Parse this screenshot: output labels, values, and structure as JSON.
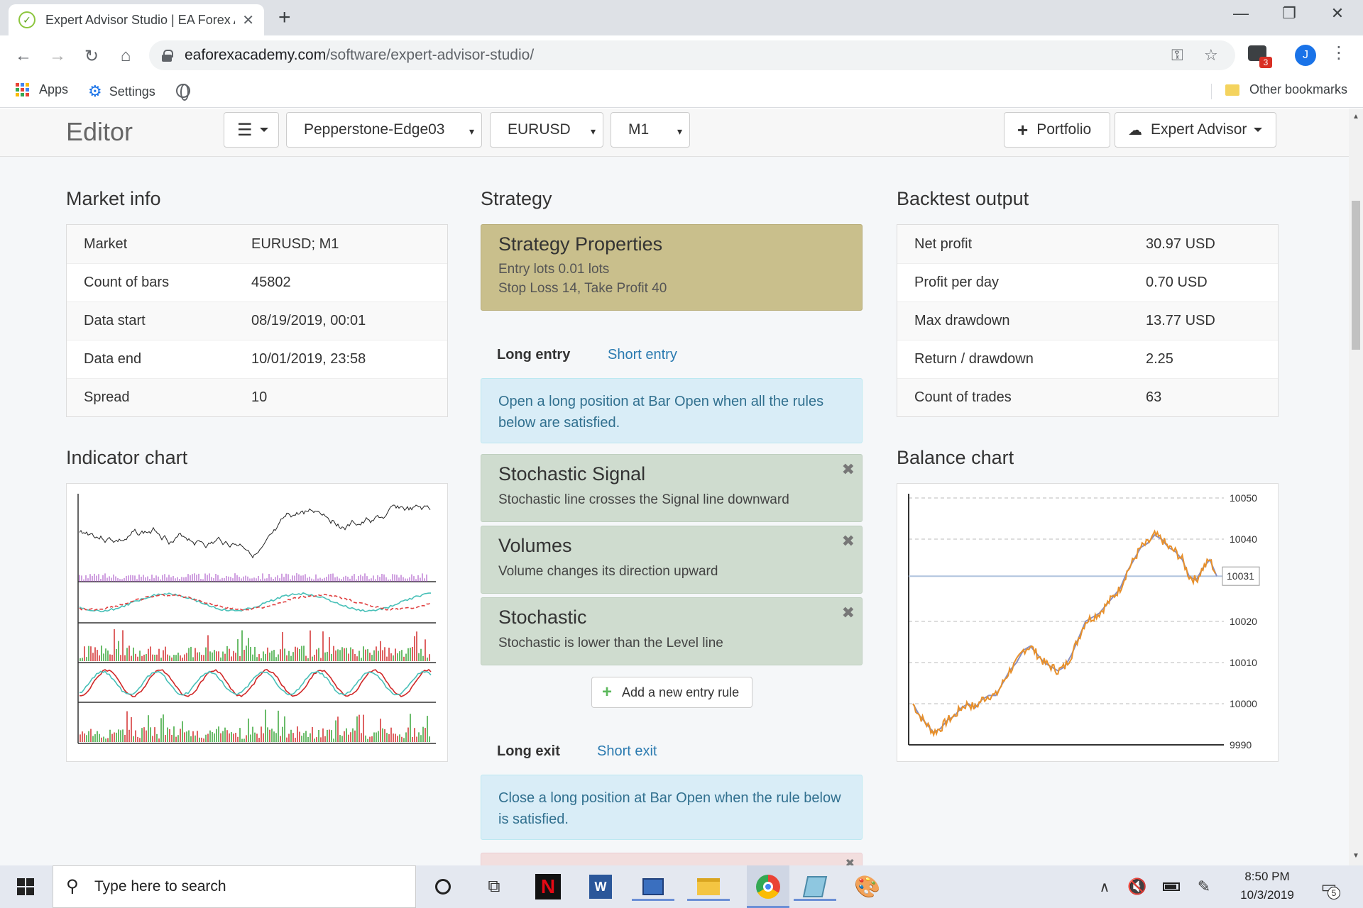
{
  "browser": {
    "tab_title": "Expert Advisor Studio | EA Forex A",
    "url_host": "eaforexacademy.com",
    "url_path": "/software/expert-advisor-studio/",
    "ext_badge": "3",
    "avatar_letter": "J",
    "bookmarks": {
      "apps": "Apps",
      "settings": "Settings",
      "other": "Other bookmarks"
    }
  },
  "editor": {
    "title": "Editor",
    "server": "Pepperstone-Edge03",
    "symbol": "EURUSD",
    "period": "M1",
    "portfolio_label": "Portfolio",
    "expert_advisor_label": "Expert Advisor"
  },
  "market_info": {
    "heading": "Market info",
    "rows": [
      {
        "key": "Market",
        "value": "EURUSD; M1"
      },
      {
        "key": "Count of bars",
        "value": "45802"
      },
      {
        "key": "Data start",
        "value": "08/19/2019, 00:01"
      },
      {
        "key": "Data end",
        "value": "10/01/2019, 23:58"
      },
      {
        "key": "Spread",
        "value": "10"
      }
    ]
  },
  "strategy": {
    "heading": "Strategy",
    "props_title": "Strategy Properties",
    "props_line1": "Entry lots 0.01 lots",
    "props_line2": "Stop Loss 14, Take Profit 40",
    "entry_tabs": {
      "long": "Long entry",
      "short": "Short entry"
    },
    "entry_info": "Open a long position at Bar Open when all the rules below are satisfied.",
    "rules": [
      {
        "title": "Stochastic Signal",
        "desc": "Stochastic line crosses the Signal line downward"
      },
      {
        "title": "Volumes",
        "desc": "Volume changes its direction upward"
      },
      {
        "title": "Stochastic",
        "desc": "Stochastic is lower than the Level line"
      }
    ],
    "add_rule_label": "Add a new entry rule",
    "exit_tabs": {
      "long": "Long exit",
      "short": "Short exit"
    },
    "exit_info": "Close a long position at Bar Open when the rule below is satisfied."
  },
  "backtest": {
    "heading": "Backtest output",
    "rows": [
      {
        "key": "Net profit",
        "value": "30.97 USD"
      },
      {
        "key": "Profit per day",
        "value": "0.70 USD"
      },
      {
        "key": "Max drawdown",
        "value": "13.77 USD"
      },
      {
        "key": "Return / drawdown",
        "value": "2.25"
      },
      {
        "key": "Count of trades",
        "value": "63"
      }
    ]
  },
  "indicator_chart": {
    "heading": "Indicator chart"
  },
  "chart_data": {
    "type": "line",
    "title": "Balance chart",
    "ylim": [
      9990,
      10050
    ],
    "yticks": [
      "10050",
      "10040",
      "10020",
      "10010",
      "10000",
      "9990"
    ],
    "current_label": "10031",
    "current_value": 10031,
    "grid": true,
    "series": [
      {
        "values": [
          10000,
          9997,
          9995,
          9993,
          9994,
          9996,
          9997,
          9999,
          10000,
          9999,
          10001,
          10002,
          10002,
          10005,
          10008,
          10010,
          10013,
          10014,
          10012,
          10010,
          10009,
          10008,
          10009,
          10012,
          10016,
          10020,
          10021,
          10022,
          10024,
          10026,
          10028,
          10032,
          10035,
          10038,
          10039,
          10041,
          10040,
          10038,
          10037,
          10035,
          10031,
          10030,
          10033,
          10035,
          10031
        ]
      }
    ]
  },
  "colors": {
    "accent_link": "#2a7ab0",
    "strategy_props_bg": "#c9bf8c",
    "rule_bg": "#cfdccf",
    "info_bg": "#d9edf7",
    "balance_line": "#8a8fbf",
    "equity_line": "#e8902a"
  },
  "taskbar": {
    "search_placeholder": "Type here to search",
    "time": "8:50 PM",
    "date": "10/3/2019",
    "notif_count": "5"
  }
}
